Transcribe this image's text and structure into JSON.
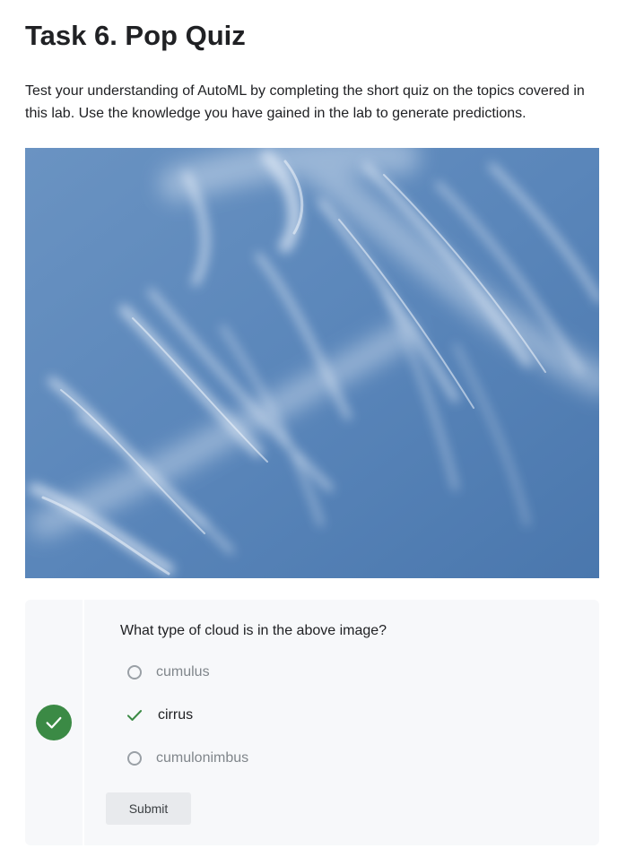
{
  "page": {
    "title": "Task 6. Pop Quiz",
    "intro": "Test your understanding of AutoML by completing the short quiz on the topics covered in this lab. Use the knowledge you have gained in the lab to generate predictions."
  },
  "quiz": {
    "question": "What type of cloud is in the above image?",
    "options": [
      {
        "label": "cumulus",
        "selected": false,
        "icon": "radio-unchecked-icon"
      },
      {
        "label": "cirrus",
        "selected": true,
        "icon": "checkmark-icon"
      },
      {
        "label": "cumulonimbus",
        "selected": false,
        "icon": "radio-unchecked-icon"
      }
    ],
    "status_icon": "check-circle-icon",
    "submit_label": "Submit"
  },
  "colors": {
    "correct": "#3b8a45",
    "card_background": "#f7f8fa",
    "sky": "#5380b3"
  }
}
